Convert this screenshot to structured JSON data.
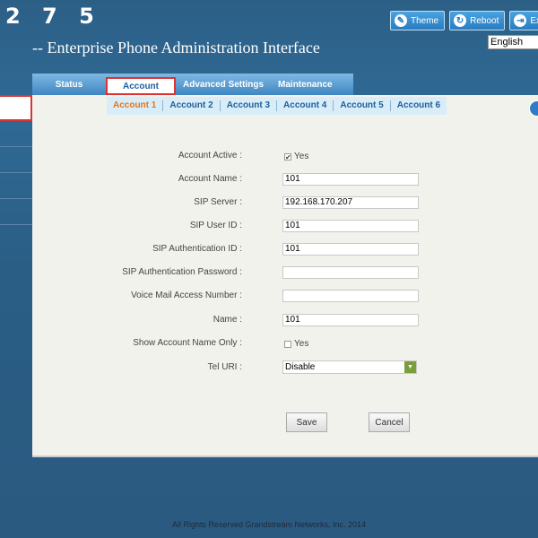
{
  "header": {
    "brand": "2 7 5",
    "subtitle": "-- Enterprise Phone Administration Interface",
    "buttons": [
      {
        "label": "Theme",
        "icon": "theme-icon"
      },
      {
        "label": "Reboot",
        "icon": "reboot-icon"
      },
      {
        "label": "Ex",
        "icon": "exit-icon"
      }
    ],
    "language": "English"
  },
  "nav": {
    "tabs": [
      "Status",
      "Account",
      "Advanced Settings",
      "Maintenance"
    ],
    "active": "Account"
  },
  "subtabs": [
    "Account 1",
    "Account 2",
    "Account 3",
    "Account 4",
    "Account 5",
    "Account 6"
  ],
  "active_subtab": "Account 1",
  "form": {
    "account_active_label": "Account Active :",
    "account_active_value": "Yes",
    "account_name_label": "Account Name :",
    "account_name_value": "101",
    "sip_server_label": "SIP Server :",
    "sip_server_value": "192.168.170.207",
    "sip_user_id_label": "SIP User ID :",
    "sip_user_id_value": "101",
    "sip_auth_id_label": "SIP Authentication ID :",
    "sip_auth_id_value": "101",
    "sip_auth_pw_label": "SIP Authentication Password :",
    "sip_auth_pw_value": "",
    "voicemail_label": "Voice Mail Access Number :",
    "voicemail_value": "",
    "name_label": "Name :",
    "name_value": "101",
    "show_name_only_label": "Show Account Name Only :",
    "show_name_only_value": "Yes",
    "tel_uri_label": "Tel URI :",
    "tel_uri_value": "Disable"
  },
  "actions": {
    "save": "Save",
    "cancel": "Cancel"
  },
  "footer": "All Rights Reserved Grandstream Networks, Inc. 2014"
}
